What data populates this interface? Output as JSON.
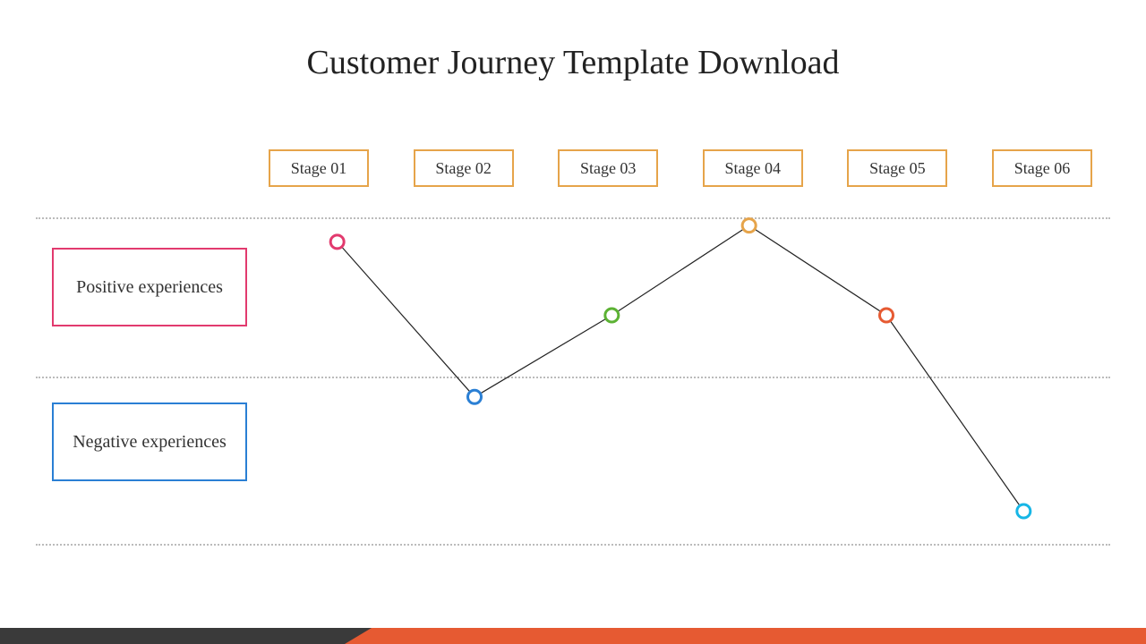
{
  "title": "Customer Journey Template Download",
  "stages": [
    "Stage 01",
    "Stage 02",
    "Stage 03",
    "Stage 04",
    "Stage 05",
    "Stage 06"
  ],
  "side": {
    "pos": "Positive experiences",
    "neg": "Negative experiences"
  },
  "chart_data": {
    "type": "line",
    "categories": [
      "Stage 01",
      "Stage 02",
      "Stage 03",
      "Stage 04",
      "Stage 05",
      "Stage 06"
    ],
    "values": [
      0.85,
      -0.1,
      0.4,
      0.95,
      0.4,
      -0.8
    ],
    "ylim": [
      -1,
      1
    ],
    "colors": [
      "#e23a6e",
      "#2a7fd4",
      "#5cb234",
      "#e6a44a",
      "#e65a32",
      "#17b6e6"
    ],
    "zones": {
      "positive": [
        0,
        1
      ],
      "negative": [
        -1,
        0
      ]
    }
  },
  "footer_colors": {
    "dark": "#3a3a3a",
    "accent": "#e65a32"
  }
}
